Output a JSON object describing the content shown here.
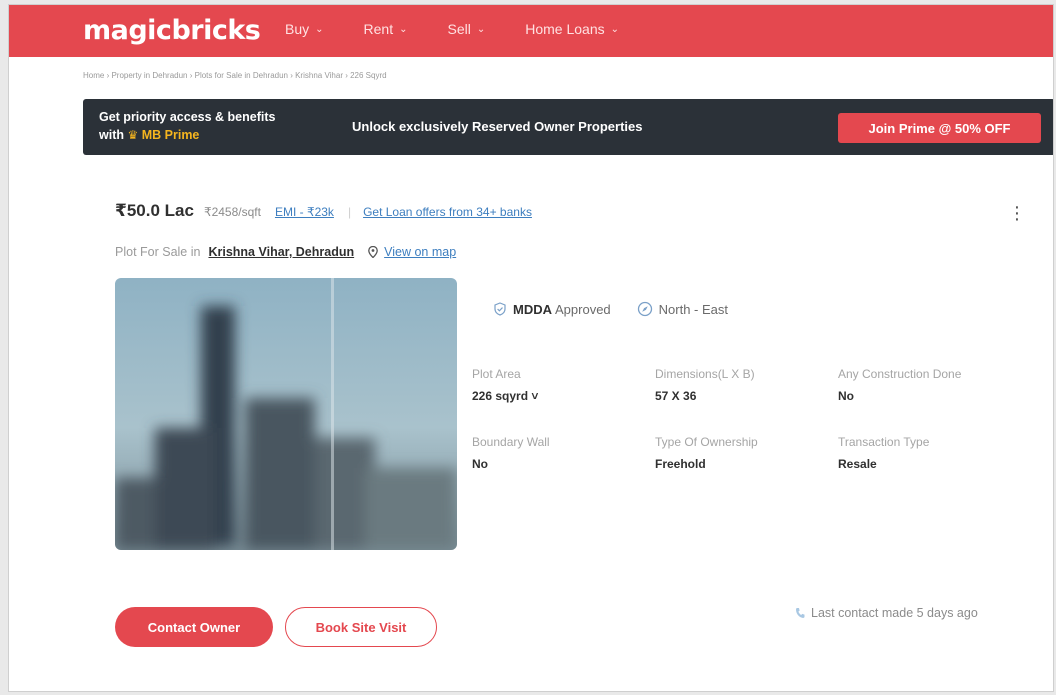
{
  "header": {
    "logo": "magicbricks",
    "nav": [
      "Buy",
      "Rent",
      "Sell",
      "Home Loans"
    ]
  },
  "breadcrumb": "Home › Property in Dehradun › Plots for Sale in Dehradun › Krishna Vihar › 226 Sqyrd",
  "prime_banner": {
    "line1": "Get priority access & benefits",
    "line2_prefix": "with",
    "line2_brand": "MB Prime",
    "message": "Unlock exclusively Reserved Owner Properties",
    "button": "Join Prime @ 50% OFF"
  },
  "listing": {
    "price": "₹50.0 Lac",
    "price_per_sqft": "₹2458/sqft",
    "emi": "EMI - ₹23k",
    "separator": "|",
    "loan_link": "Get Loan offers from 34+ banks",
    "location_prefix": "Plot For Sale in",
    "location": "Krishna Vihar, Dehradun",
    "map_link": "View on map",
    "badges": [
      {
        "bold": "MDDA",
        "text": "Approved"
      },
      {
        "bold": "",
        "text": "North - East"
      }
    ],
    "facts": [
      {
        "label": "Plot Area",
        "value": "226 sqyrd ˅"
      },
      {
        "label": "Dimensions(L X B)",
        "value": "57 X 36"
      },
      {
        "label": "Any Construction Done",
        "value": "No"
      },
      {
        "label": "Boundary Wall",
        "value": "No"
      },
      {
        "label": "Type Of Ownership",
        "value": "Freehold"
      },
      {
        "label": "Transaction Type",
        "value": "Resale"
      }
    ],
    "contact_button": "Contact Owner",
    "visit_button": "Book Site Visit",
    "last_contact": "Last contact made 5 days ago"
  },
  "colors": {
    "brand": "#e4484f",
    "banner_bg": "#2b3138",
    "prime_gold": "#f5b51f",
    "link": "#3d7ebf"
  }
}
